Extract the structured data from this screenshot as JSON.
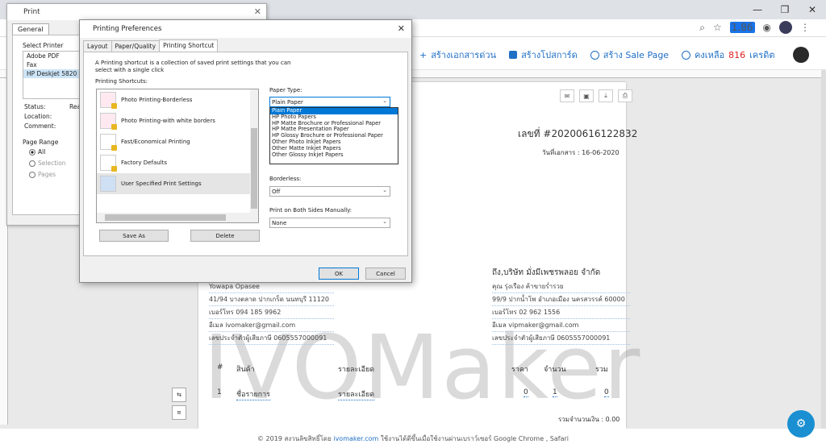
{
  "browser": {
    "ext_badge": "1.86",
    "win_min": "—",
    "win_max": "❐",
    "win_close": "✕",
    "toolbar_icons": [
      "☆",
      "⋮"
    ]
  },
  "appnav": {
    "quick_doc": "สร้างเอกสารด่วน",
    "promo": "สร้างโปสการ์ด",
    "sale_page": "สร้าง Sale Page",
    "credit_prefix": "คงเหลือ",
    "credit_num": "816",
    "credit_suffix": "เครดิต"
  },
  "doc": {
    "number": "เลขที่ #20200616122832",
    "date": "วันที่เอกสาร : 16-06-2020",
    "watermark": "IVOMaker",
    "seller": [
      "Yowapa Opasee",
      "41/94 บางตลาด ปากเกร็ด นนทบุรี 11120",
      "เบอร์โทร 094 185 9962",
      "อีเมล ivomaker@gmail.com",
      "เลขประจำตัวผู้เสียภาษี 0605557000091"
    ],
    "customer_title": "ถึง,บริษัท มั่งมีเพชรพลอย จำกัด",
    "customer": [
      "คุณ รุ่งเรือง ค้าขายร่ำรวย",
      "99/9 ปากน้ำโพ อำเภอเมือง นครสวรรค์ 60000",
      "เบอร์โทร 02 962 1556",
      "อีเมล vipmaker@gmail.com",
      "เลขประจำตัวผู้เสียภาษี 0605557000091"
    ],
    "items_header": {
      "no": "#",
      "product": "สินค้า",
      "detail": "รายละเอียด",
      "price": "ราคา",
      "qty": "จำนวน",
      "sum": "รวม"
    },
    "item_row": {
      "no": "1",
      "product": "ชื่อรายการ",
      "detail": "รายละเอียด",
      "price": "0",
      "qty": "1",
      "sum": "0"
    },
    "total": "รวมจำนวนเงิน : 0.00"
  },
  "footer": {
    "text1": "© 2019 สงวนลิขสิทธิ์โดย",
    "link": "ivomaker.com",
    "text2": "ใช้งานได้ดีขึ้นเมื่อใช้งานผ่านเบราว์เซอร์ Google Chrome , Safari"
  },
  "print_dialog": {
    "title": "Print",
    "tab": "General",
    "select_printer": "Select Printer",
    "printers": [
      "Adobe PDF",
      "Fax",
      "HP Deskjet 5820"
    ],
    "status_label": "Status:",
    "status_value": "Read",
    "location_label": "Location:",
    "comment_label": "Comment:",
    "page_range": "Page Range",
    "range_all": "All",
    "range_selection": "Selection",
    "range_pages": "Pages"
  },
  "pref_dialog": {
    "title": "Printing Preferences",
    "tabs": [
      "Layout",
      "Paper/Quality",
      "Printing Shortcut"
    ],
    "description": "A Printing shortcut is a collection of saved print settings that you can select with a single click",
    "shortcuts_label": "Printing Shortcuts:",
    "shortcuts": [
      "Photo Printing-Borderless",
      "Photo Printing-with white borders",
      "Fast/Economical Printing",
      "Factory Defaults",
      "User Specified Print Settings"
    ],
    "save_as": "Save As",
    "delete": "Delete",
    "paper_type_label": "Paper Type:",
    "paper_type_value": "Plain Paper",
    "paper_type_options": [
      "Plain Paper",
      "HP Photo Papers",
      "HP Matte Brochure or Professional Paper",
      "HP Matte Presentation Paper",
      "HP Glossy Brochure or Professional Paper",
      "Other Photo Inkjet Papers",
      "Other Matte Inkjet Papers",
      "Other Glossy Inkjet Papers"
    ],
    "borderless_label": "Borderless:",
    "borderless_value": "Off",
    "both_sides_label": "Print on Both Sides Manually:",
    "both_sides_value": "None",
    "ok": "OK",
    "cancel": "Cancel"
  }
}
